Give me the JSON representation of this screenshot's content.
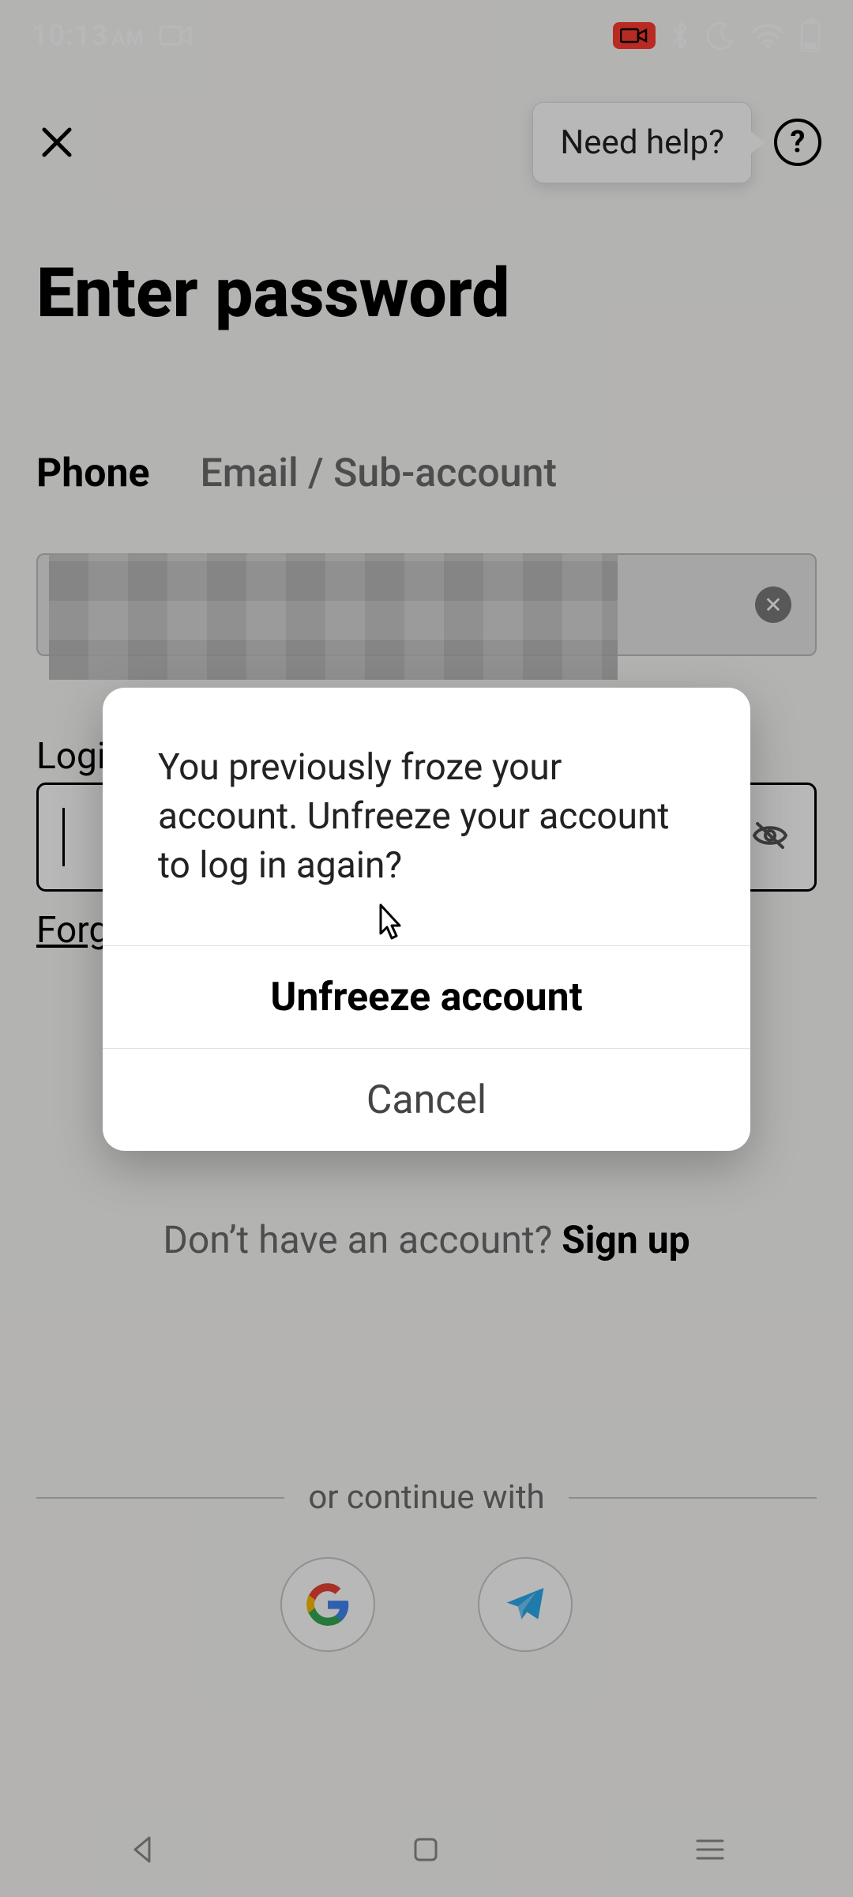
{
  "status": {
    "time": "10:13",
    "ampm": "AM"
  },
  "header": {
    "help_tooltip": "Need help?",
    "help_question": "?"
  },
  "page": {
    "title": "Enter password"
  },
  "tabs": {
    "phone": "Phone",
    "email": "Email / Sub-account"
  },
  "phone_input": {
    "clear_glyph": "✕"
  },
  "password": {
    "label_visible": "Logi",
    "forgot_visible": "Forg"
  },
  "signup": {
    "prompt": "Don’t have an account? ",
    "link": "Sign up"
  },
  "divider": {
    "text": "or continue with"
  },
  "modal": {
    "message": "You previously froze your account. Unfreeze your account to log in again?",
    "primary": "Unfreeze account",
    "secondary": "Cancel"
  }
}
